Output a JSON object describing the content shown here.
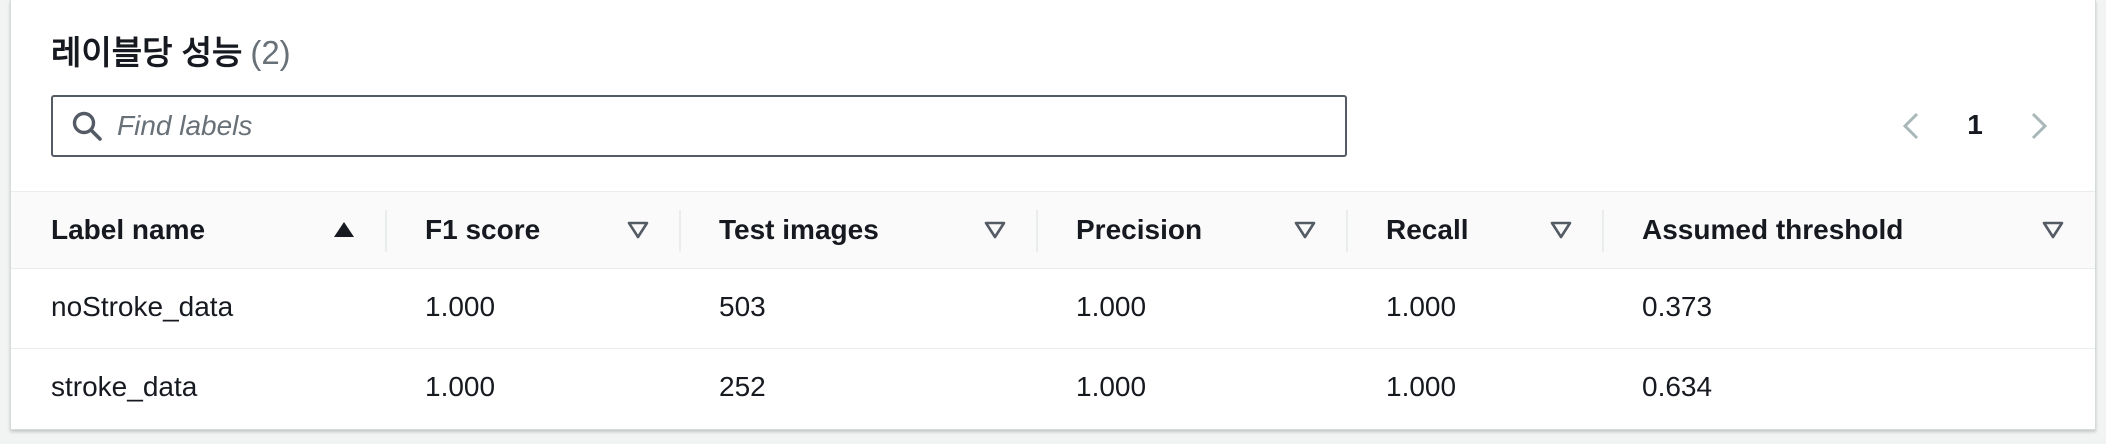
{
  "panel": {
    "title": "레이블당 성능",
    "count": "(2)"
  },
  "search": {
    "placeholder": "Find labels",
    "value": ""
  },
  "pagination": {
    "current_page": "1"
  },
  "table": {
    "columns": [
      {
        "label": "Label name",
        "sort": "ascending"
      },
      {
        "label": "F1 score",
        "sort": "none"
      },
      {
        "label": "Test images",
        "sort": "none"
      },
      {
        "label": "Precision",
        "sort": "none"
      },
      {
        "label": "Recall",
        "sort": "none"
      },
      {
        "label": "Assumed threshold",
        "sort": "none"
      }
    ],
    "rows": [
      {
        "label_name": "noStroke_data",
        "f1_score": "1.000",
        "test_images": "503",
        "precision": "1.000",
        "recall": "1.000",
        "assumed_threshold": "0.373"
      },
      {
        "label_name": "stroke_data",
        "f1_score": "1.000",
        "test_images": "252",
        "precision": "1.000",
        "recall": "1.000",
        "assumed_threshold": "0.634"
      }
    ]
  }
}
